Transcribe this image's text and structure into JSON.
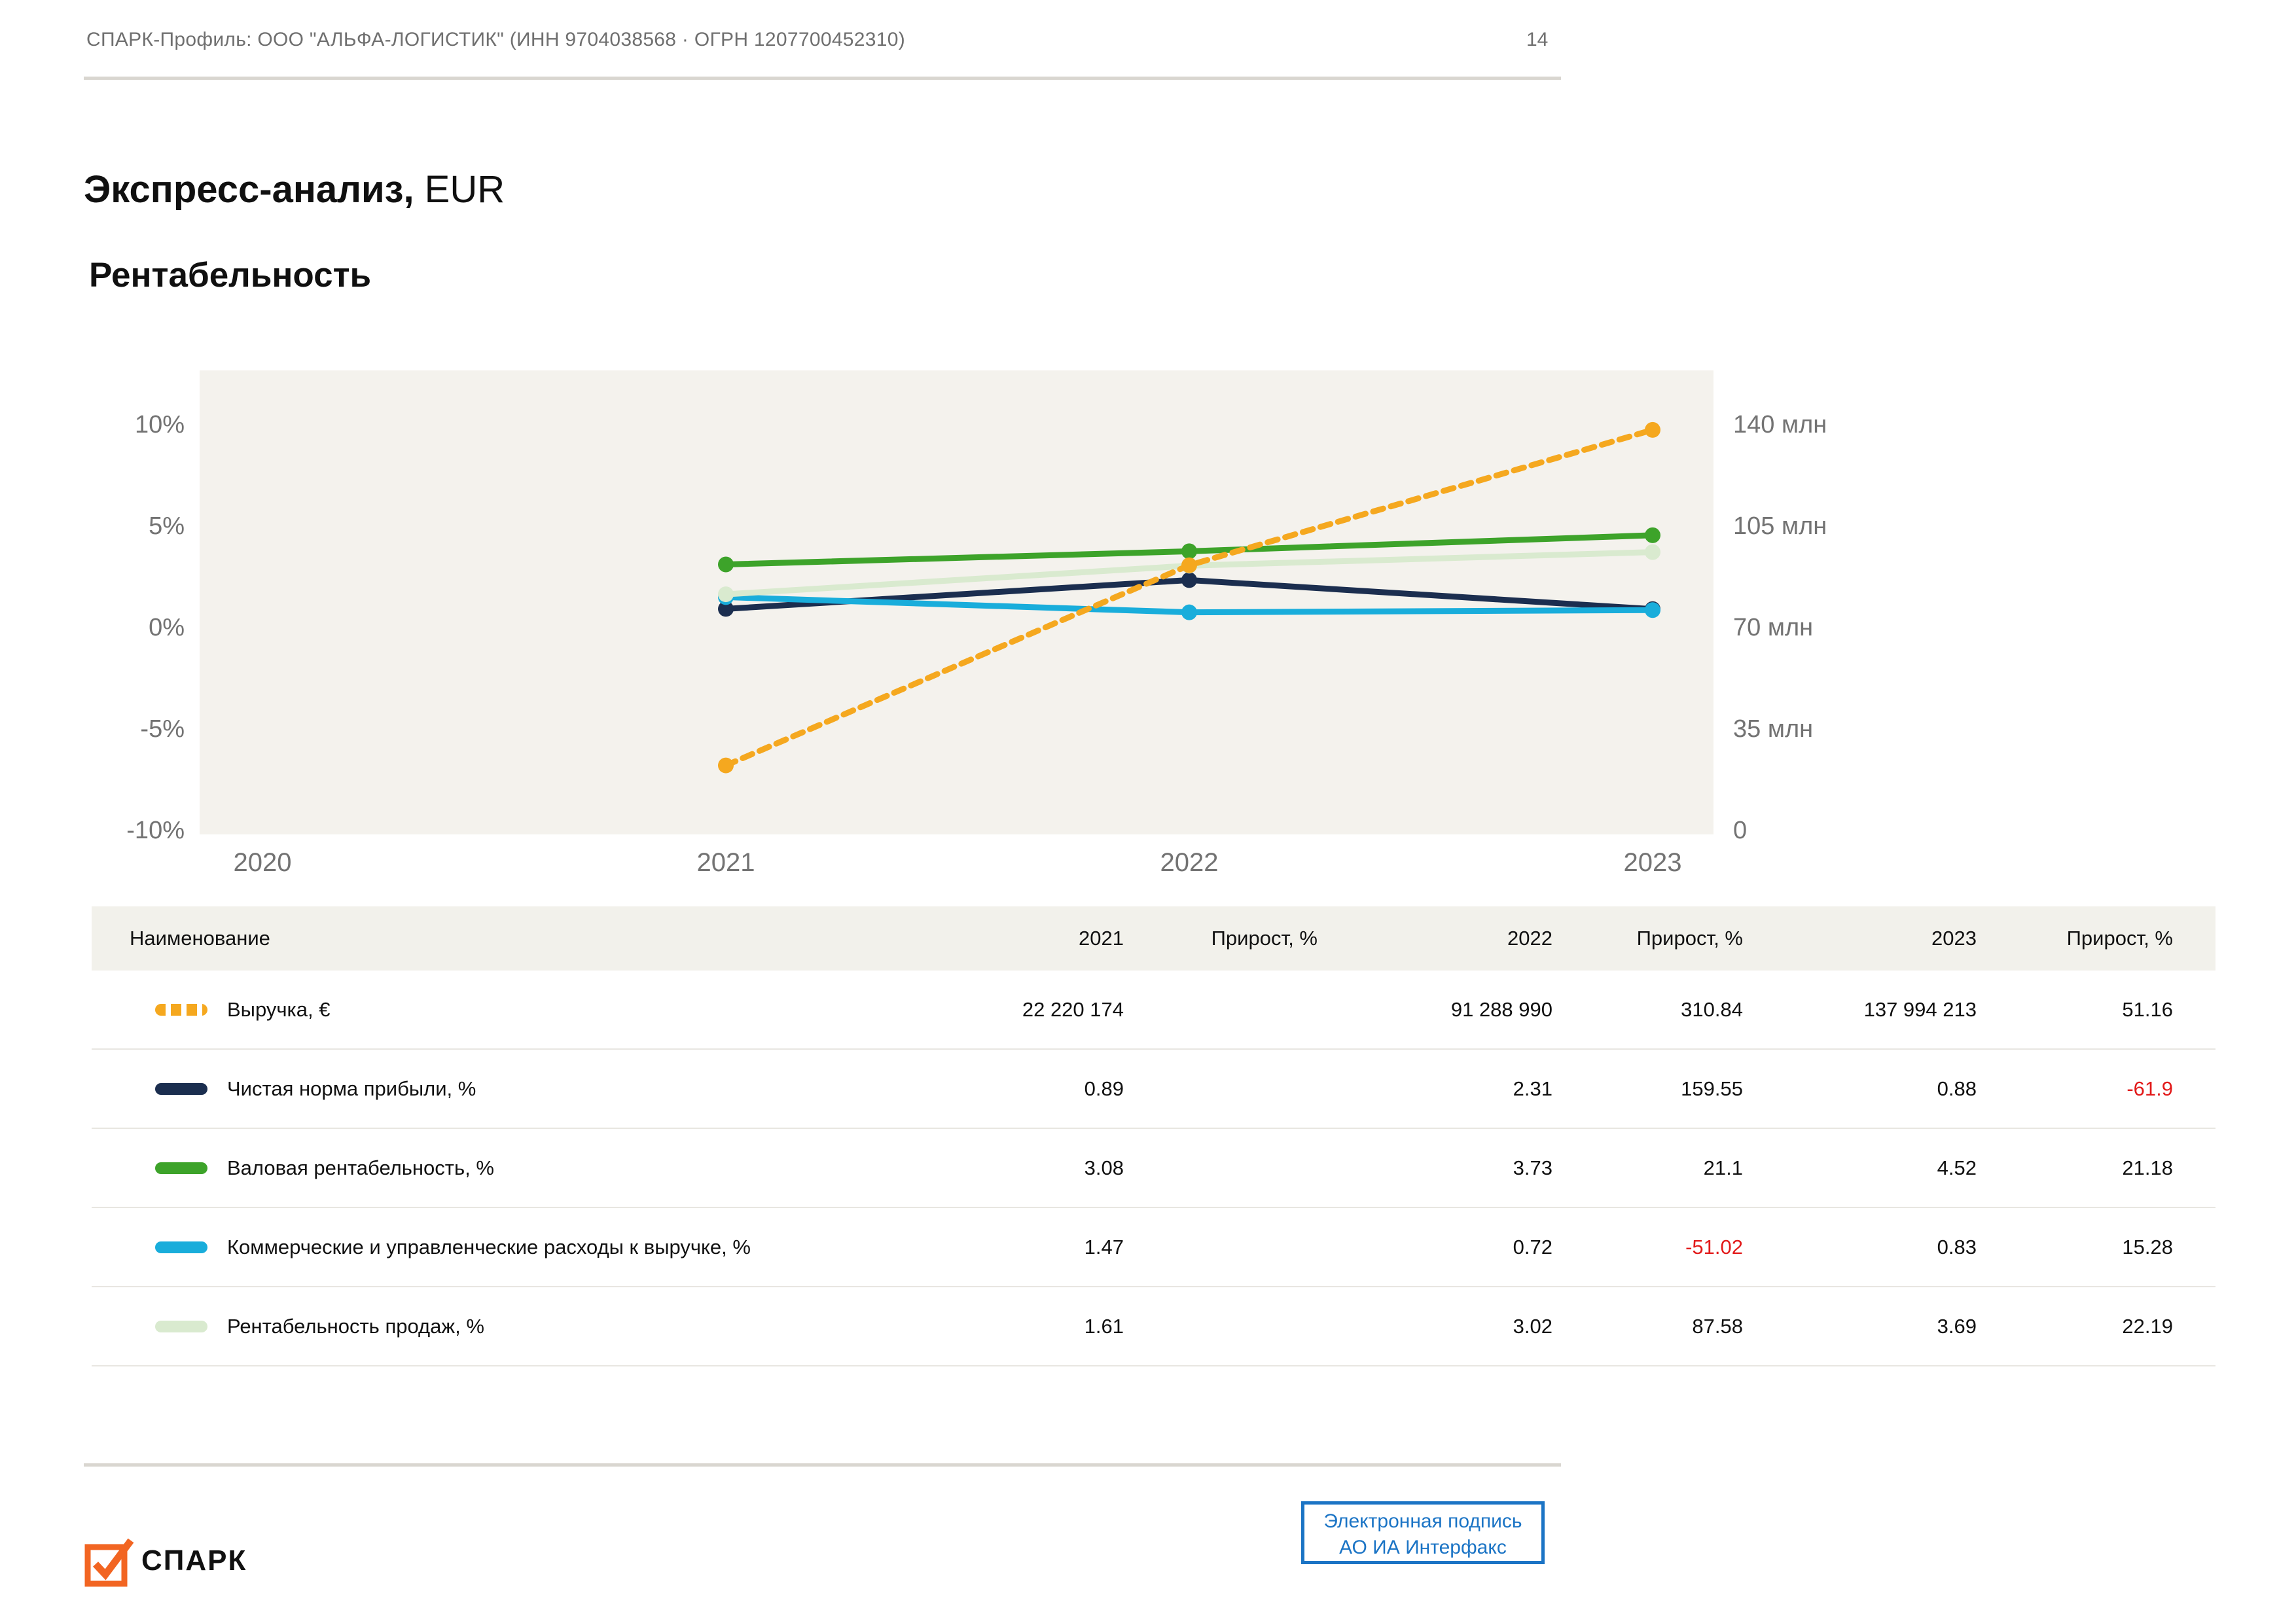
{
  "header": {
    "text": "СПАРК-Профиль: ООО \"АЛЬФА-ЛОГИСТИК\" (ИНН 9704038568 · ОГРН 1207700452310)",
    "page": "14"
  },
  "title": {
    "bold": "Экспресс-анализ,",
    "regular": " EUR"
  },
  "section": "Рентабельность",
  "colors": {
    "revenue_orange": "#F5A81F",
    "net_margin_navy": "#1B2E4F",
    "gross_margin_green": "#3DA32A",
    "expenses_cyan": "#19ADDB",
    "ros_palegreen": "#D9EACF",
    "negative_red": "#E21A1A",
    "signature_blue": "#1B74C5",
    "logo_orange": "#F26522",
    "chart_bg": "#F4F2ED"
  },
  "chart_data": {
    "type": "line",
    "x": [
      2020,
      2021,
      2022,
      2023
    ],
    "left_axis": {
      "ticks": [
        "10%",
        "5%",
        "0%",
        "-5%",
        "-10%"
      ],
      "min": -10,
      "max": 10,
      "grid": false
    },
    "right_axis": {
      "ticks": [
        "140 млн",
        "105 млн",
        "70 млн",
        "35 млн",
        "0"
      ],
      "min": 0,
      "max": 140000000
    },
    "legend_position": "table-below",
    "series": [
      {
        "name": "Выручка, €",
        "axis": "right",
        "style": "dashed",
        "color": "#F5A81F",
        "values": [
          null,
          22220174,
          91288990,
          137994213
        ]
      },
      {
        "name": "Чистая норма прибыли, %",
        "axis": "left",
        "style": "solid",
        "color": "#1B2E4F",
        "values": [
          null,
          0.89,
          2.31,
          0.88
        ]
      },
      {
        "name": "Валовая рентабельность, %",
        "axis": "left",
        "style": "solid",
        "color": "#3DA32A",
        "values": [
          null,
          3.08,
          3.73,
          4.52
        ]
      },
      {
        "name": "Коммерческие и управленческие расходы к выручке, %",
        "axis": "left",
        "style": "solid",
        "color": "#19ADDB",
        "values": [
          null,
          1.47,
          0.72,
          0.83
        ]
      },
      {
        "name": "Рентабельность продаж, %",
        "axis": "left",
        "style": "solid",
        "color": "#D9EACF",
        "values": [
          null,
          1.61,
          3.02,
          3.69
        ]
      }
    ]
  },
  "table": {
    "columns": [
      "Наименование",
      "2021",
      "Прирост, %",
      "2022",
      "Прирост, %",
      "2023",
      "Прирост, %"
    ],
    "rows": [
      {
        "label": "Выручка, €",
        "swatch": {
          "color": "#F5A81F",
          "dashed": true
        },
        "values": [
          "22 220 174",
          "",
          "91 288 990",
          "310.84",
          "137 994 213",
          "51.16"
        ]
      },
      {
        "label": "Чистая норма прибыли, %",
        "swatch": {
          "color": "#1B2E4F",
          "dashed": false
        },
        "values": [
          "0.89",
          "",
          "2.31",
          "159.55",
          "0.88",
          "-61.9"
        ]
      },
      {
        "label": "Валовая рентабельность, %",
        "swatch": {
          "color": "#3DA32A",
          "dashed": false
        },
        "values": [
          "3.08",
          "",
          "3.73",
          "21.1",
          "4.52",
          "21.18"
        ]
      },
      {
        "label": "Коммерческие и управленческие расходы к выручке, %",
        "swatch": {
          "color": "#19ADDB",
          "dashed": false
        },
        "values": [
          "1.47",
          "",
          "0.72",
          "-51.02",
          "0.83",
          "15.28"
        ]
      },
      {
        "label": "Рентабельность продаж, %",
        "swatch": {
          "color": "#D9EACF",
          "dashed": false
        },
        "values": [
          "1.61",
          "",
          "3.02",
          "87.58",
          "3.69",
          "22.19"
        ]
      }
    ]
  },
  "footer": {
    "brand": "СПАРК",
    "signature": [
      "Электронная подпись",
      "АО ИА Интерфакс"
    ]
  }
}
